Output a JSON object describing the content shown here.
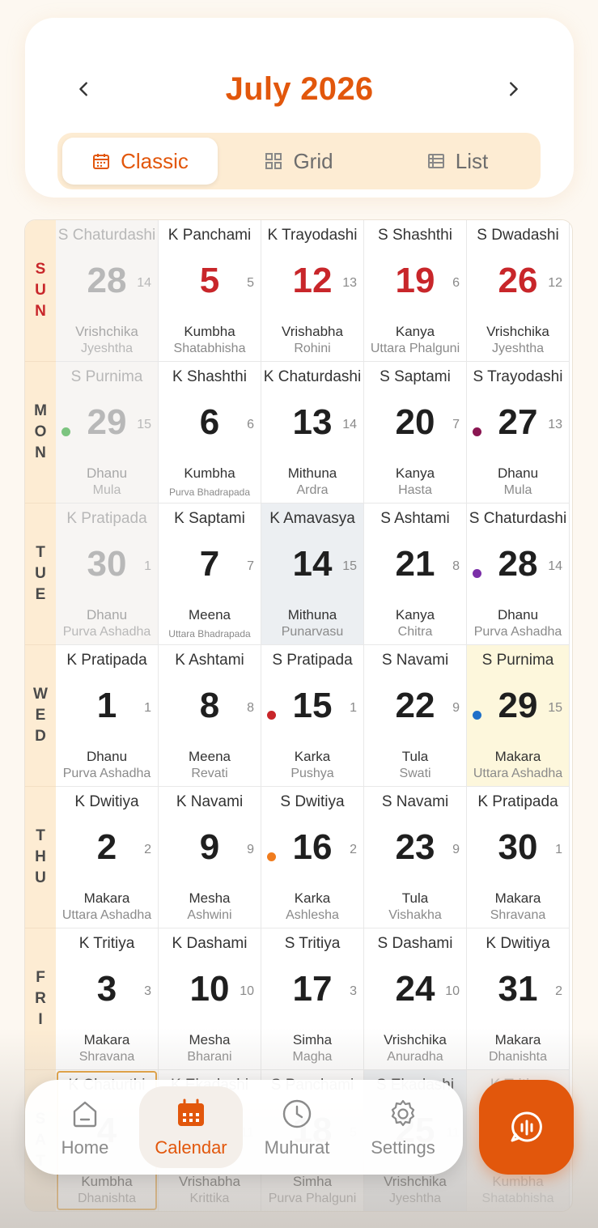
{
  "header": {
    "month_title": "July 2026",
    "view_tabs": [
      {
        "label": "Classic",
        "icon": "calendar-icon",
        "active": true
      },
      {
        "label": "Grid",
        "icon": "grid-icon",
        "active": false
      },
      {
        "label": "List",
        "icon": "list-icon",
        "active": false
      }
    ]
  },
  "days": [
    {
      "name": "SUN",
      "letters": [
        "S",
        "U",
        "N"
      ]
    },
    {
      "name": "MON",
      "letters": [
        "M",
        "O",
        "N"
      ]
    },
    {
      "name": "TUE",
      "letters": [
        "T",
        "U",
        "E"
      ]
    },
    {
      "name": "WED",
      "letters": [
        "W",
        "E",
        "D"
      ]
    },
    {
      "name": "THU",
      "letters": [
        "T",
        "H",
        "U"
      ]
    },
    {
      "name": "FRI",
      "letters": [
        "F",
        "R",
        "I"
      ]
    },
    {
      "name": "SAT",
      "letters": [
        "S",
        "A",
        "T"
      ]
    }
  ],
  "weeks": [
    [
      {
        "tithi": "S Chaturdashi",
        "date": "28",
        "small": "14",
        "rashi": "Vrishchika",
        "nak": "Jyeshtha",
        "faded": true
      },
      {
        "tithi": "S Purnima",
        "date": "29",
        "small": "15",
        "rashi": "Dhanu",
        "nak": "Mula",
        "faded": true,
        "dot": "#7cc47f"
      },
      {
        "tithi": "K Pratipada",
        "date": "30",
        "small": "1",
        "rashi": "Dhanu",
        "nak": "Purva Ashadha",
        "faded": true
      },
      {
        "tithi": "K Pratipada",
        "date": "1",
        "small": "1",
        "rashi": "Dhanu",
        "nak": "Purva Ashadha"
      },
      {
        "tithi": "K Dwitiya",
        "date": "2",
        "small": "2",
        "rashi": "Makara",
        "nak": "Uttara Ashadha"
      },
      {
        "tithi": "K Tritiya",
        "date": "3",
        "small": "3",
        "rashi": "Makara",
        "nak": "Shravana"
      },
      {
        "tithi": "K Chaturthi",
        "date": "4",
        "small": "4",
        "rashi": "Kumbha",
        "nak": "Dhanishta"
      }
    ],
    [
      {
        "tithi": "K Panchami",
        "date": "5",
        "small": "5",
        "rashi": "Kumbha",
        "nak": "Shatabhisha"
      },
      {
        "tithi": "K Shashthi",
        "date": "6",
        "small": "6",
        "rashi": "Kumbha",
        "nak": "Purva Bhadrapada",
        "tiny": true
      },
      {
        "tithi": "K Saptami",
        "date": "7",
        "small": "7",
        "rashi": "Meena",
        "nak": "Uttara Bhadrapada",
        "tiny": true
      },
      {
        "tithi": "K Ashtami",
        "date": "8",
        "small": "8",
        "rashi": "Meena",
        "nak": "Revati"
      },
      {
        "tithi": "K Navami",
        "date": "9",
        "small": "9",
        "rashi": "Mesha",
        "nak": "Ashwini"
      },
      {
        "tithi": "K Dashami",
        "date": "10",
        "small": "10",
        "rashi": "Mesha",
        "nak": "Bharani"
      },
      {
        "tithi": "K Ekadashi",
        "date": "11",
        "small": "11",
        "rashi": "Vrishabha",
        "nak": "Krittika"
      }
    ],
    [
      {
        "tithi": "K Trayodashi",
        "date": "12",
        "small": "13",
        "rashi": "Vrishabha",
        "nak": "Rohini"
      },
      {
        "tithi": "K Chaturdashi",
        "date": "13",
        "small": "14",
        "rashi": "Mithuna",
        "nak": "Ardra"
      },
      {
        "tithi": "K Amavasya",
        "date": "14",
        "small": "15",
        "rashi": "Mithuna",
        "nak": "Punarvasu",
        "amavasya": true
      },
      {
        "tithi": "S Pratipada",
        "date": "15",
        "small": "1",
        "rashi": "Karka",
        "nak": "Pushya",
        "dot": "#c8262a"
      },
      {
        "tithi": "S Dwitiya",
        "date": "16",
        "small": "2",
        "rashi": "Karka",
        "nak": "Ashlesha",
        "dot": "#f07c1e"
      },
      {
        "tithi": "S Tritiya",
        "date": "17",
        "small": "3",
        "rashi": "Simha",
        "nak": "Magha"
      },
      {
        "tithi": "S Panchami",
        "date": "18",
        "small": "5",
        "rashi": "Simha",
        "nak": "Purva Phalguni"
      }
    ],
    [
      {
        "tithi": "S Shashthi",
        "date": "19",
        "small": "6",
        "rashi": "Kanya",
        "nak": "Uttara Phalguni"
      },
      {
        "tithi": "S Saptami",
        "date": "20",
        "small": "7",
        "rashi": "Kanya",
        "nak": "Hasta"
      },
      {
        "tithi": "S Ashtami",
        "date": "21",
        "small": "8",
        "rashi": "Kanya",
        "nak": "Chitra"
      },
      {
        "tithi": "S Navami",
        "date": "22",
        "small": "9",
        "rashi": "Tula",
        "nak": "Swati"
      },
      {
        "tithi": "S Navami",
        "date": "23",
        "small": "9",
        "rashi": "Tula",
        "nak": "Vishakha"
      },
      {
        "tithi": "S Dashami",
        "date": "24",
        "small": "10",
        "rashi": "Vrishchika",
        "nak": "Anuradha"
      },
      {
        "tithi": "S Ekadashi",
        "date": "25",
        "small": "11",
        "rashi": "Vrishchika",
        "nak": "Jyeshtha",
        "amavasya": true
      }
    ],
    [
      {
        "tithi": "S Dwadashi",
        "date": "26",
        "small": "12",
        "rashi": "Vrishchika",
        "nak": "Jyeshtha"
      },
      {
        "tithi": "S Trayodashi",
        "date": "27",
        "small": "13",
        "rashi": "Dhanu",
        "nak": "Mula",
        "dot": "#8a1652"
      },
      {
        "tithi": "S Chaturdashi",
        "date": "28",
        "small": "14",
        "rashi": "Dhanu",
        "nak": "Purva Ashadha",
        "dot": "#7b2fa8"
      },
      {
        "tithi": "S Purnima",
        "date": "29",
        "small": "15",
        "rashi": "Makara",
        "nak": "Uttara Ashadha",
        "purnima": true,
        "dot": "#1f6fc8"
      },
      {
        "tithi": "K Pratipada",
        "date": "30",
        "small": "1",
        "rashi": "Makara",
        "nak": "Shravana"
      },
      {
        "tithi": "K Dwitiya",
        "date": "31",
        "small": "2",
        "rashi": "Makara",
        "nak": "Dhanishta"
      },
      {
        "tithi": "K Tritiya",
        "date": "1",
        "small": "3",
        "rashi": "Kumbha",
        "nak": "Shatabhisha",
        "faded": true
      }
    ]
  ],
  "bottom_nav": {
    "items": [
      {
        "label": "Home",
        "icon": "home-icon",
        "active": false
      },
      {
        "label": "Calendar",
        "icon": "calendar-icon",
        "active": true
      },
      {
        "label": "Muhurat",
        "icon": "clock-icon",
        "active": false
      },
      {
        "label": "Settings",
        "icon": "gear-icon",
        "active": false
      }
    ],
    "fab_icon": "voice-chat-icon"
  },
  "colors": {
    "accent": "#e2570c",
    "sunday_red": "#c8262a",
    "day_column_bg": "#fdecd3"
  }
}
